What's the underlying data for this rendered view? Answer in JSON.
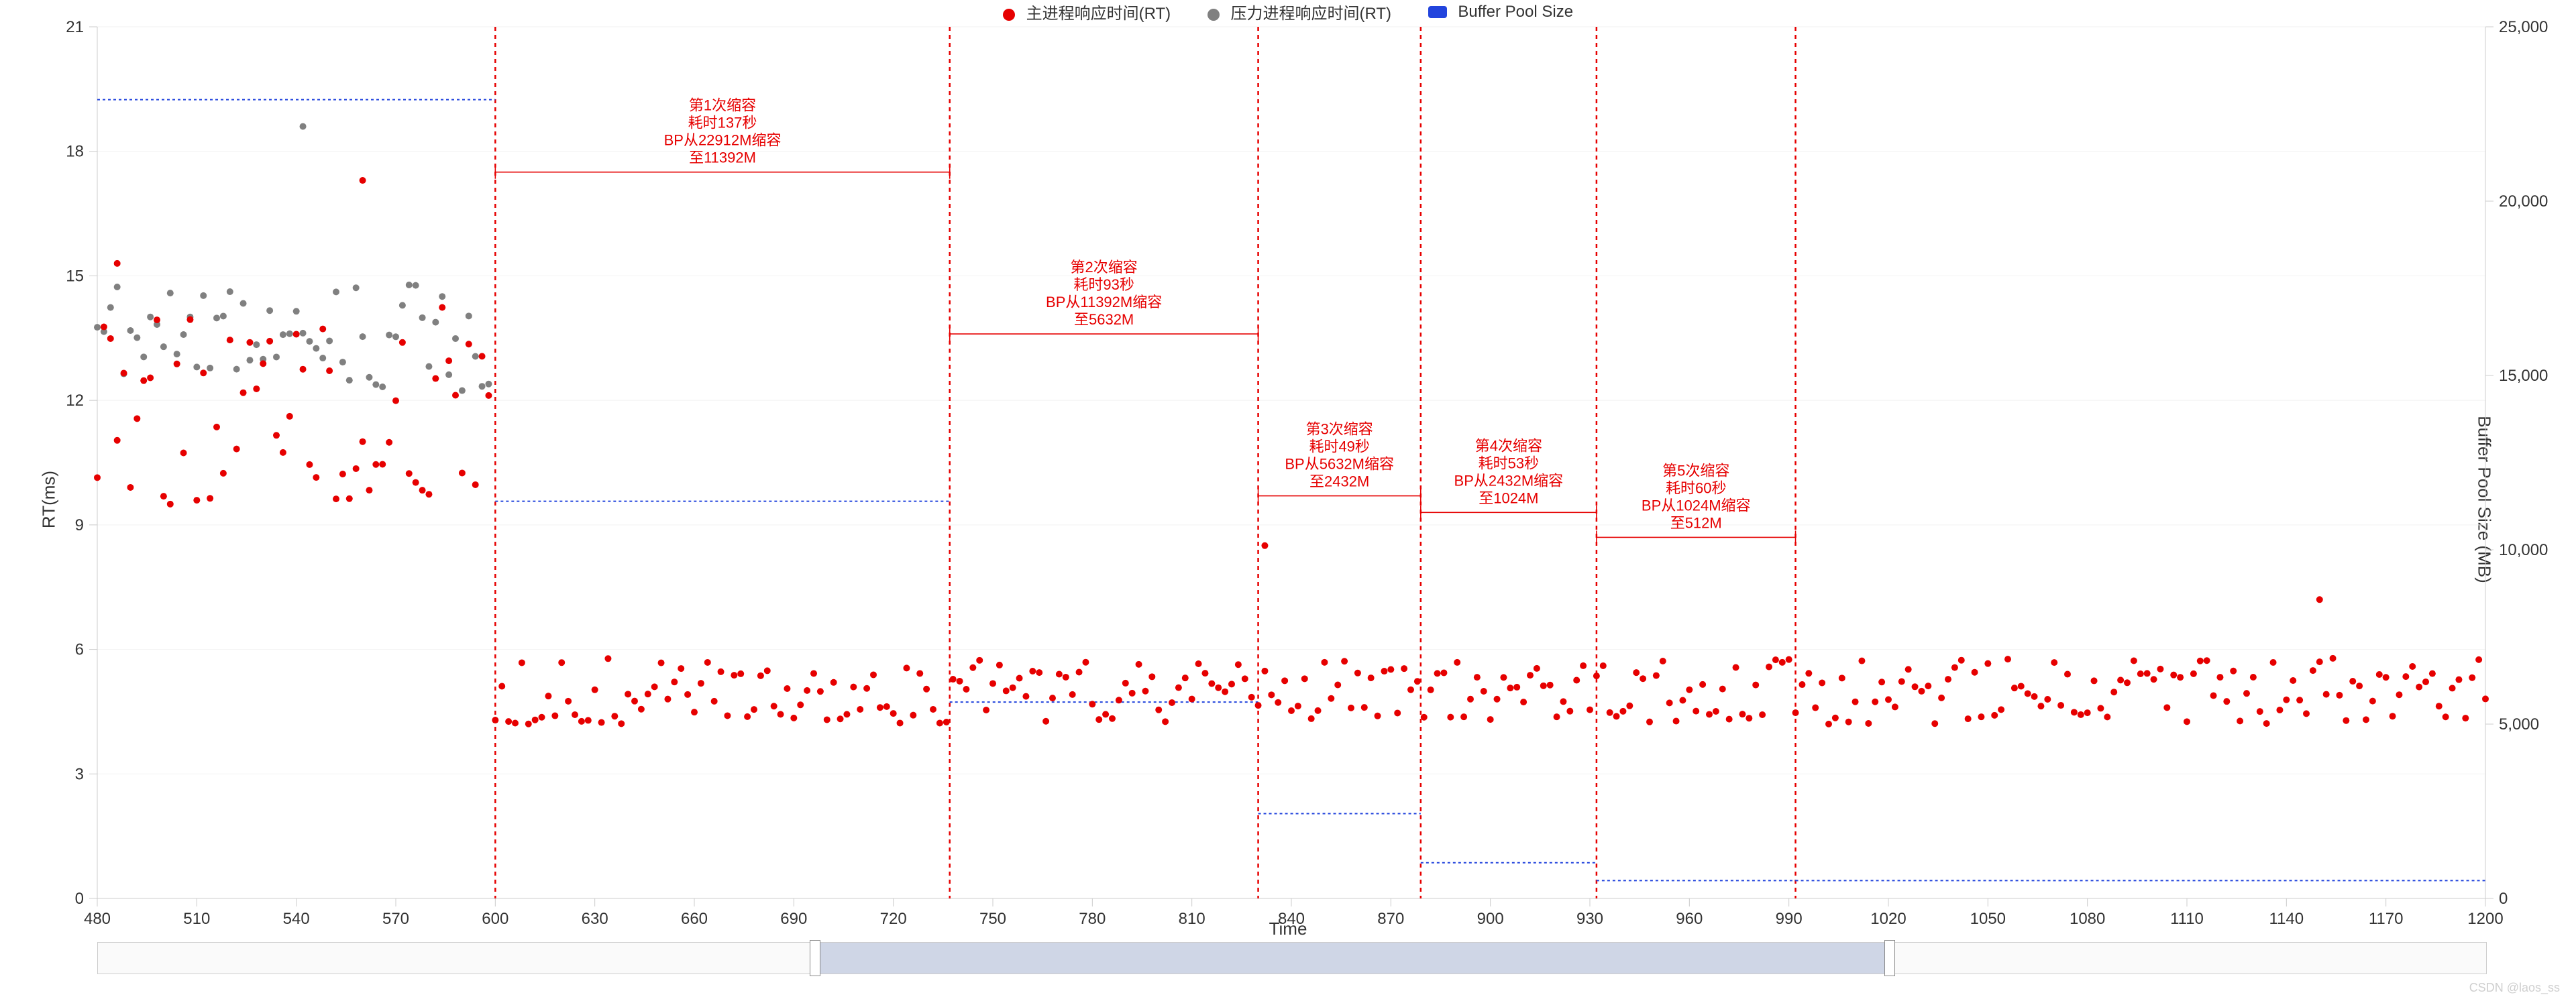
{
  "legend": {
    "items": [
      {
        "label": "主进程响应时间(RT)",
        "kind": "dot",
        "color": "#e60000"
      },
      {
        "label": "压力进程响应时间(RT)",
        "kind": "dot",
        "color": "#808080"
      },
      {
        "label": "Buffer Pool Size",
        "kind": "swatch",
        "color": "#2244dd"
      }
    ]
  },
  "axes": {
    "x": {
      "label": "Time",
      "min": 480,
      "max": 1200,
      "ticks": [
        480,
        510,
        540,
        570,
        600,
        630,
        660,
        690,
        720,
        750,
        780,
        810,
        840,
        870,
        900,
        930,
        960,
        990,
        1020,
        1050,
        1080,
        1110,
        1140,
        1170,
        1200
      ]
    },
    "y1": {
      "label": "RT(ms)",
      "min": 0,
      "max": 21,
      "ticks": [
        0,
        3,
        6,
        9,
        12,
        15,
        18,
        21
      ]
    },
    "y2": {
      "label": "Buffer Pool Size (MB)",
      "min": 0,
      "max": 25000,
      "ticks": [
        0,
        5000,
        10000,
        15000,
        20000,
        25000
      ],
      "tick_format": "thousands"
    }
  },
  "vlines": [
    600,
    737,
    830,
    879,
    932,
    992
  ],
  "annotations": [
    {
      "r": 17.5,
      "x1": 600,
      "x2": 737,
      "lines": [
        "第1次缩容",
        "耗时137秒",
        "BP从22912M缩容",
        "至11392M"
      ]
    },
    {
      "r": 13.6,
      "x1": 737,
      "x2": 830,
      "lines": [
        "第2次缩容",
        "耗时93秒",
        "BP从11392M缩容",
        "至5632M"
      ]
    },
    {
      "r": 9.7,
      "x1": 830,
      "x2": 879,
      "lines": [
        "第3次缩容",
        "耗时49秒",
        "BP从5632M缩容",
        "至2432M"
      ]
    },
    {
      "r": 9.3,
      "x1": 879,
      "x2": 932,
      "lines": [
        "第4次缩容",
        "耗时53秒",
        "BP从2432M缩容",
        "至1024M"
      ]
    },
    {
      "r": 8.7,
      "x1": 932,
      "x2": 992,
      "lines": [
        "第5次缩容",
        "耗时60秒",
        "BP从1024M缩容",
        "至512M"
      ]
    }
  ],
  "slider": {
    "full_min": 0,
    "full_max": 1600,
    "sel_min": 480,
    "sel_max": 1200
  },
  "watermark": "CSDN @laos_ss",
  "chart_data": {
    "type": "scatter",
    "xlabel": "Time",
    "ylabel": "RT(ms)",
    "ylim": [
      0,
      21
    ],
    "y2label": "Buffer Pool Size (MB)",
    "y2lim": [
      0,
      25000
    ],
    "x_range": [
      480,
      1200
    ],
    "series": [
      {
        "name": "主进程响应时间(RT)",
        "color": "#e60000",
        "axis": "y1",
        "kind": "scatter",
        "note": "Dense scatter. Values are approximate: roughly 10–15 ms for x<600, dropping abruptly to ~4–6 ms for x>=600.",
        "generator": {
          "segments": [
            {
              "x1": 480,
              "x2": 598,
              "mean": 12.0,
              "spread": 2.5,
              "step": 2
            },
            {
              "x1": 600,
              "x2": 1200,
              "mean": 5.0,
              "spread": 0.8,
              "step": 2
            }
          ],
          "outliers": [
            {
              "x": 486,
              "y": 15.3
            },
            {
              "x": 560,
              "y": 17.3
            },
            {
              "x": 832,
              "y": 8.5
            },
            {
              "x": 1150,
              "y": 7.2
            }
          ]
        }
      },
      {
        "name": "压力进程响应时间(RT)",
        "color": "#808080",
        "axis": "y1",
        "kind": "scatter",
        "note": "Only present for x<600. Cluster ~12.5–14.5 ms.",
        "generator": {
          "segments": [
            {
              "x1": 480,
              "x2": 598,
              "mean": 13.5,
              "spread": 1.3,
              "step": 2
            }
          ],
          "outliers": [
            {
              "x": 542,
              "y": 18.6
            }
          ]
        }
      },
      {
        "name": "Buffer Pool Size",
        "color": "#2244dd",
        "axis": "y2",
        "kind": "step-line",
        "step_points": [
          {
            "x": 480,
            "y": 22912
          },
          {
            "x": 600,
            "y": 22912
          },
          {
            "x": 600,
            "y": 11392
          },
          {
            "x": 737,
            "y": 11392
          },
          {
            "x": 737,
            "y": 5632
          },
          {
            "x": 830,
            "y": 5632
          },
          {
            "x": 830,
            "y": 2432
          },
          {
            "x": 879,
            "y": 2432
          },
          {
            "x": 879,
            "y": 1024
          },
          {
            "x": 932,
            "y": 1024
          },
          {
            "x": 932,
            "y": 512
          },
          {
            "x": 992,
            "y": 512
          },
          {
            "x": 1200,
            "y": 512
          }
        ]
      }
    ],
    "annotations_text": [
      "第1次缩容 耗时137秒 BP从22912M缩容至11392M",
      "第2次缩容 耗时93秒 BP从11392M缩容至5632M",
      "第3次缩容 耗时49秒 BP从5632M缩容至2432M",
      "第4次缩容 耗时53秒 BP从2432M缩容至1024M",
      "第5次缩容 耗时60秒 BP从1024M缩容至512M"
    ],
    "vlines_x": [
      600,
      737,
      830,
      879,
      932,
      992
    ]
  }
}
